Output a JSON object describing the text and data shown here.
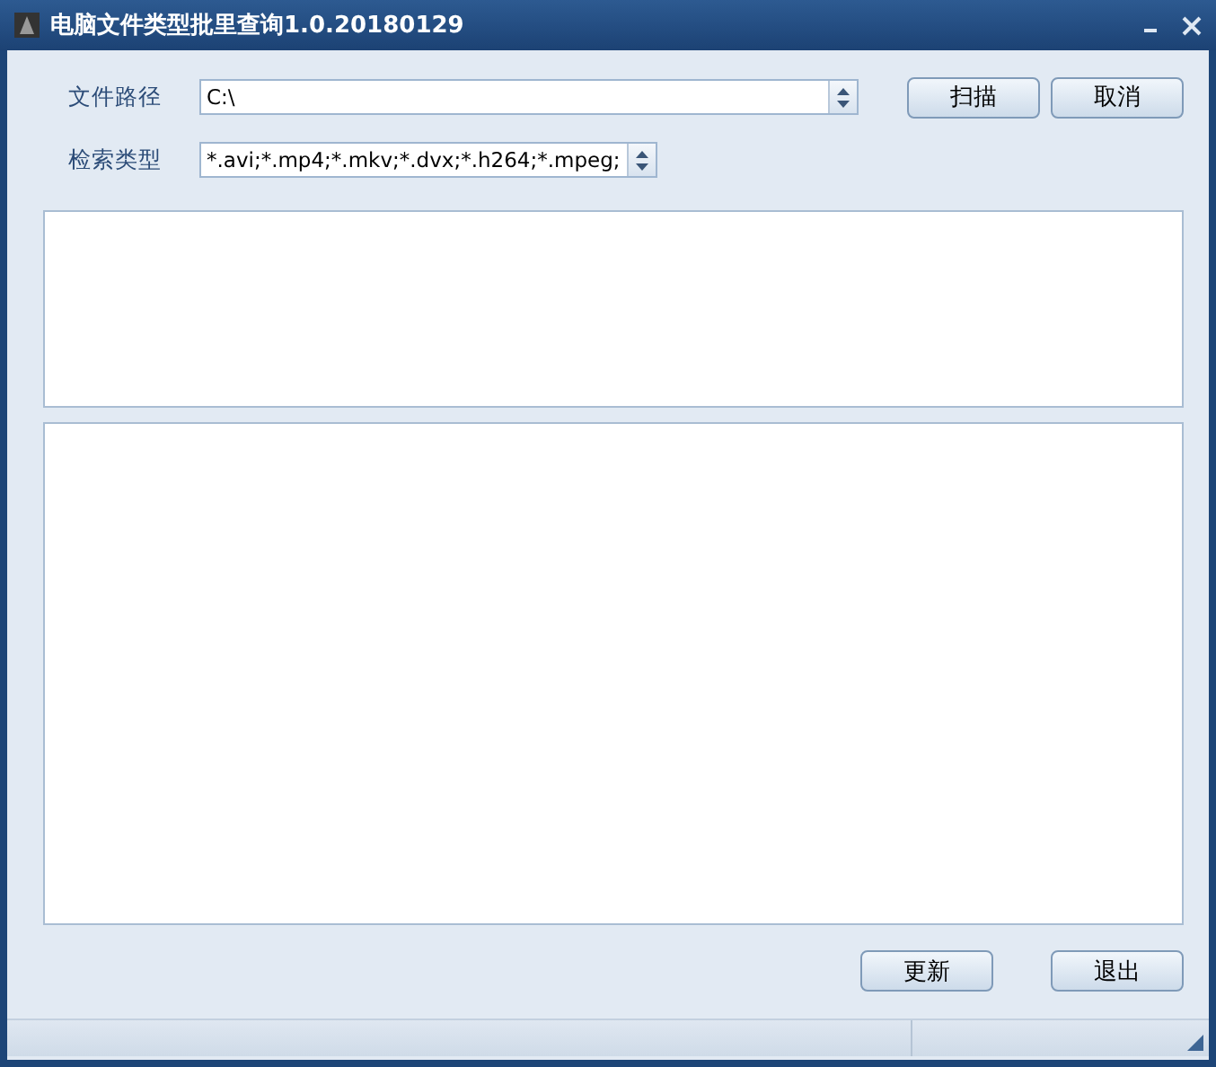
{
  "window": {
    "title": "电脑文件类型批里查询1.0.20180129"
  },
  "fields": [
    {
      "label": "文件路径",
      "value": "C:\\"
    },
    {
      "label": "检索类型",
      "value": "*.avi;*.mp4;*.mkv;*.dvx;*.h264;*.mpeg;"
    }
  ],
  "top_buttons": [
    "扫描",
    "取消"
  ],
  "bottom_buttons": [
    "更新",
    "退出"
  ]
}
